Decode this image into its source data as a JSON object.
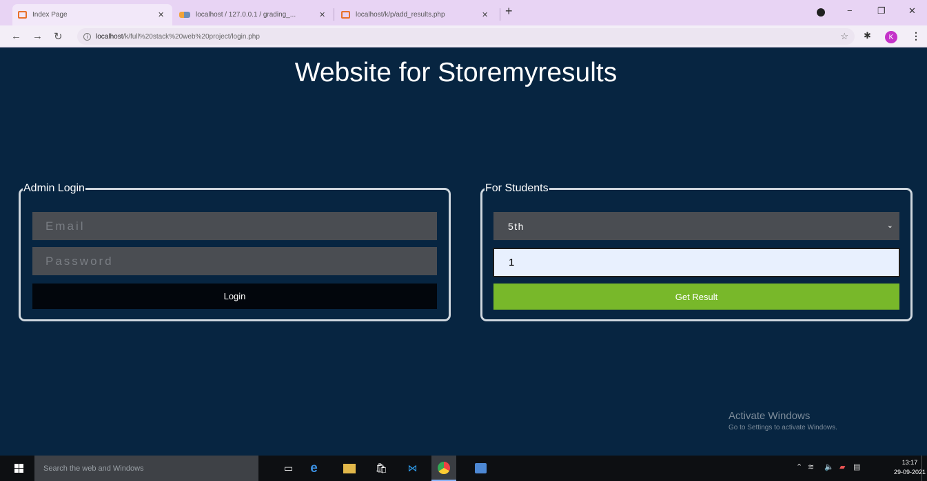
{
  "browser": {
    "tabs": [
      {
        "title": "Index Page",
        "active": true
      },
      {
        "title": "localhost / 127.0.0.1 / grading_...",
        "active": false
      },
      {
        "title": "localhost/k/p/add_results.php",
        "active": false
      }
    ],
    "close_glyph": "✕",
    "new_tab_glyph": "+",
    "url_host": "localhost",
    "url_path": "/k/full%20stack%20web%20project/login.php",
    "avatar_letter": "K",
    "window_controls": {
      "minimize": "−",
      "maximize": "❐",
      "close": "✕"
    }
  },
  "page": {
    "title": "Website for Storemyresults",
    "admin": {
      "legend": "Admin Login",
      "email_placeholder": "Email",
      "password_placeholder": "Password",
      "login_label": "Login"
    },
    "students": {
      "legend": "For Students",
      "class_selected": "5th",
      "roll_value": "1",
      "button_label": "Get Result",
      "button_color": "#78b82a"
    }
  },
  "watermark": {
    "title": "Activate Windows",
    "subtitle": "Go to Settings to activate Windows."
  },
  "taskbar": {
    "search_placeholder": "Search the web and Windows",
    "time": "13:17",
    "date": "29-09-2021"
  },
  "colors": {
    "page_background": "#072541",
    "input_background": "#4a4d52",
    "login_button": "#02060c"
  }
}
